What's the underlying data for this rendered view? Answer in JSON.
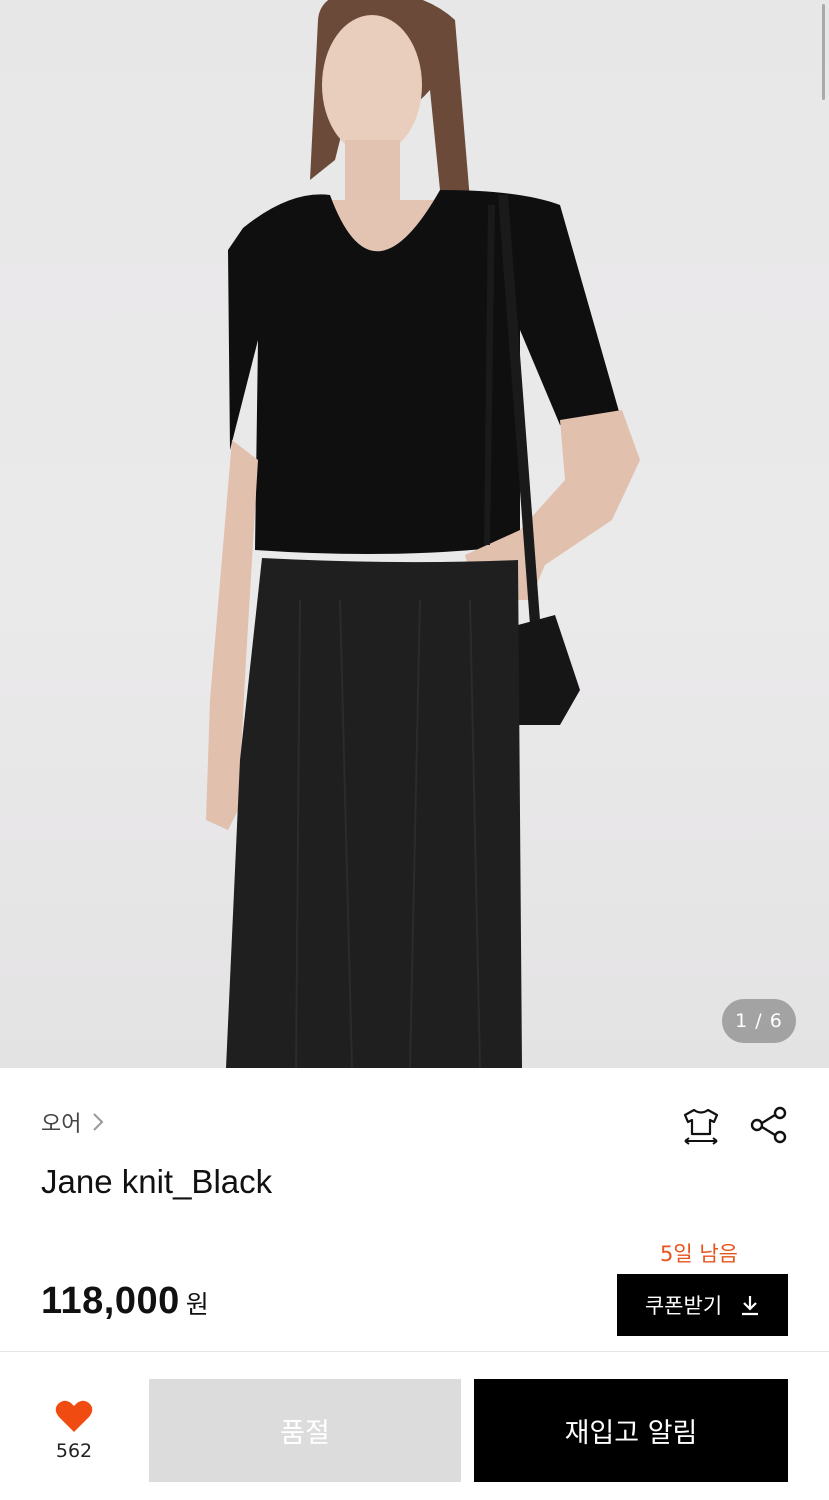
{
  "gallery": {
    "counter": "1 / 6"
  },
  "product": {
    "brand": "오어",
    "name": "Jane knit_Black",
    "price": "118,000",
    "currency": "원"
  },
  "coupon": {
    "remaining": "5일 남음",
    "label": "쿠폰받기"
  },
  "actions": {
    "like_count": "562",
    "soldout_label": "품절",
    "restock_label": "재입고 알림"
  },
  "icons": {
    "size_guide": "size-guide-shirt-icon",
    "share": "share-icon",
    "like": "heart-icon",
    "coupon_download": "download-icon",
    "brand_link": "chevron-right-icon"
  },
  "colors": {
    "accent": "#e8541e",
    "primary_button": "#000000",
    "disabled_button": "#dcdcdc"
  }
}
